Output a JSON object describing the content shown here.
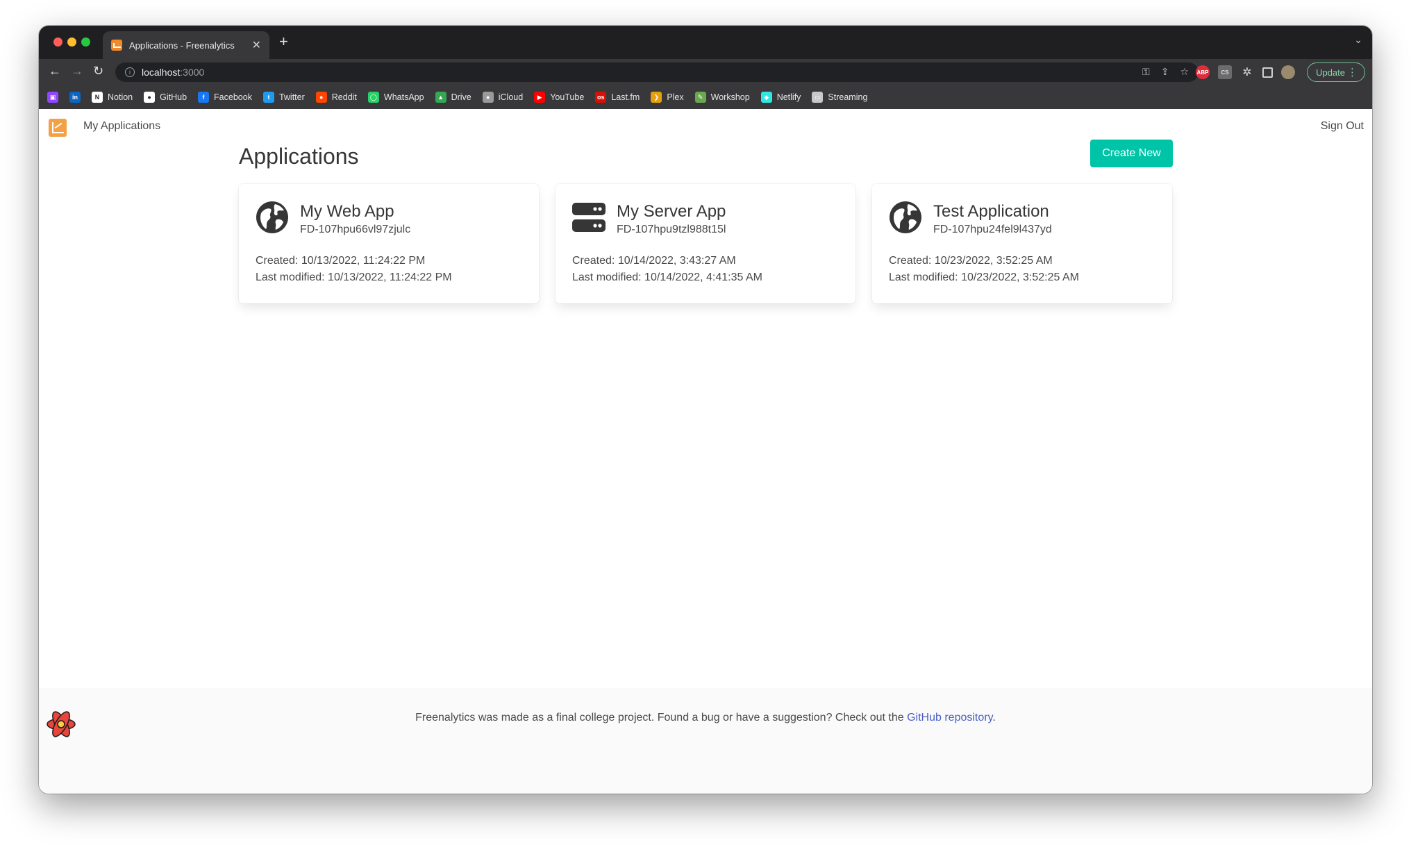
{
  "browser": {
    "tab": {
      "title": "Applications - Freenalytics",
      "close": "✕"
    },
    "new_tab": "+",
    "tab_menu": "⌄",
    "nav": {
      "back": "←",
      "forward": "→",
      "reload": "↻"
    },
    "url": {
      "host": "localhost",
      "port": ":3000"
    },
    "omni_icons": [
      "key-icon",
      "share-icon",
      "star-icon"
    ],
    "extensions": [
      {
        "name": "abp-icon",
        "text": "ABP"
      },
      {
        "name": "cs-icon",
        "text": "CS"
      }
    ],
    "update_label": "Update",
    "bookmarks": [
      {
        "label": "",
        "icon": "twitch-icon",
        "color": "#9146ff",
        "glyph": "▣"
      },
      {
        "label": "",
        "icon": "linkedin-icon",
        "color": "#0a66c2",
        "glyph": "in"
      },
      {
        "label": "Notion",
        "icon": "notion-icon",
        "color": "#ffffff",
        "glyph": "N"
      },
      {
        "label": "GitHub",
        "icon": "github-icon",
        "color": "#ffffff",
        "glyph": "●"
      },
      {
        "label": "Facebook",
        "icon": "facebook-icon",
        "color": "#1877f2",
        "glyph": "f"
      },
      {
        "label": "Twitter",
        "icon": "twitter-icon",
        "color": "#1d9bf0",
        "glyph": "t"
      },
      {
        "label": "Reddit",
        "icon": "reddit-icon",
        "color": "#ff4500",
        "glyph": "●"
      },
      {
        "label": "WhatsApp",
        "icon": "whatsapp-icon",
        "color": "#25d366",
        "glyph": "◯"
      },
      {
        "label": "Drive",
        "icon": "drive-icon",
        "color": "#34a853",
        "glyph": "▲"
      },
      {
        "label": "iCloud",
        "icon": "apple-icon",
        "color": "#9a9a9a",
        "glyph": "●"
      },
      {
        "label": "YouTube",
        "icon": "youtube-icon",
        "color": "#ff0000",
        "glyph": "▶"
      },
      {
        "label": "Last.fm",
        "icon": "lastfm-icon",
        "color": "#d51007",
        "glyph": "os"
      },
      {
        "label": "Plex",
        "icon": "plex-icon",
        "color": "#e5a00d",
        "glyph": "❯"
      },
      {
        "label": "Workshop",
        "icon": "workshop-icon",
        "color": "#6aa84f",
        "glyph": "✎"
      },
      {
        "label": "Netlify",
        "icon": "netlify-icon",
        "color": "#32e6e2",
        "glyph": "◆"
      },
      {
        "label": "Streaming",
        "icon": "folder-icon",
        "color": "#c8c8c8",
        "glyph": "▭"
      }
    ]
  },
  "navbar": {
    "brand_label": "My Applications",
    "signout_label": "Sign Out"
  },
  "main": {
    "heading": "Applications",
    "create_label": "Create New",
    "cards": [
      {
        "icon": "globe-icon",
        "title": "My Web App",
        "id": "FD-107hpu66vl97zjulc",
        "created": "Created: 10/13/2022, 11:24:22 PM",
        "modified": "Last modified: 10/13/2022, 11:24:22 PM"
      },
      {
        "icon": "server-icon",
        "title": "My Server App",
        "id": "FD-107hpu9tzl988t15l",
        "created": "Created: 10/14/2022, 3:43:27 AM",
        "modified": "Last modified: 10/14/2022, 4:41:35 AM"
      },
      {
        "icon": "globe-icon",
        "title": "Test Application",
        "id": "FD-107hpu24fel9l437yd",
        "created": "Created: 10/23/2022, 3:52:25 AM",
        "modified": "Last modified: 10/23/2022, 3:52:25 AM"
      }
    ]
  },
  "footer": {
    "text": "Freenalytics was made as a final college project. Found a bug or have a suggestion? Check out the ",
    "link": "GitHub repository",
    "end": "."
  },
  "colors": {
    "primary": "#00c4a7",
    "link": "#485fc7",
    "brand": "#f4a045"
  }
}
